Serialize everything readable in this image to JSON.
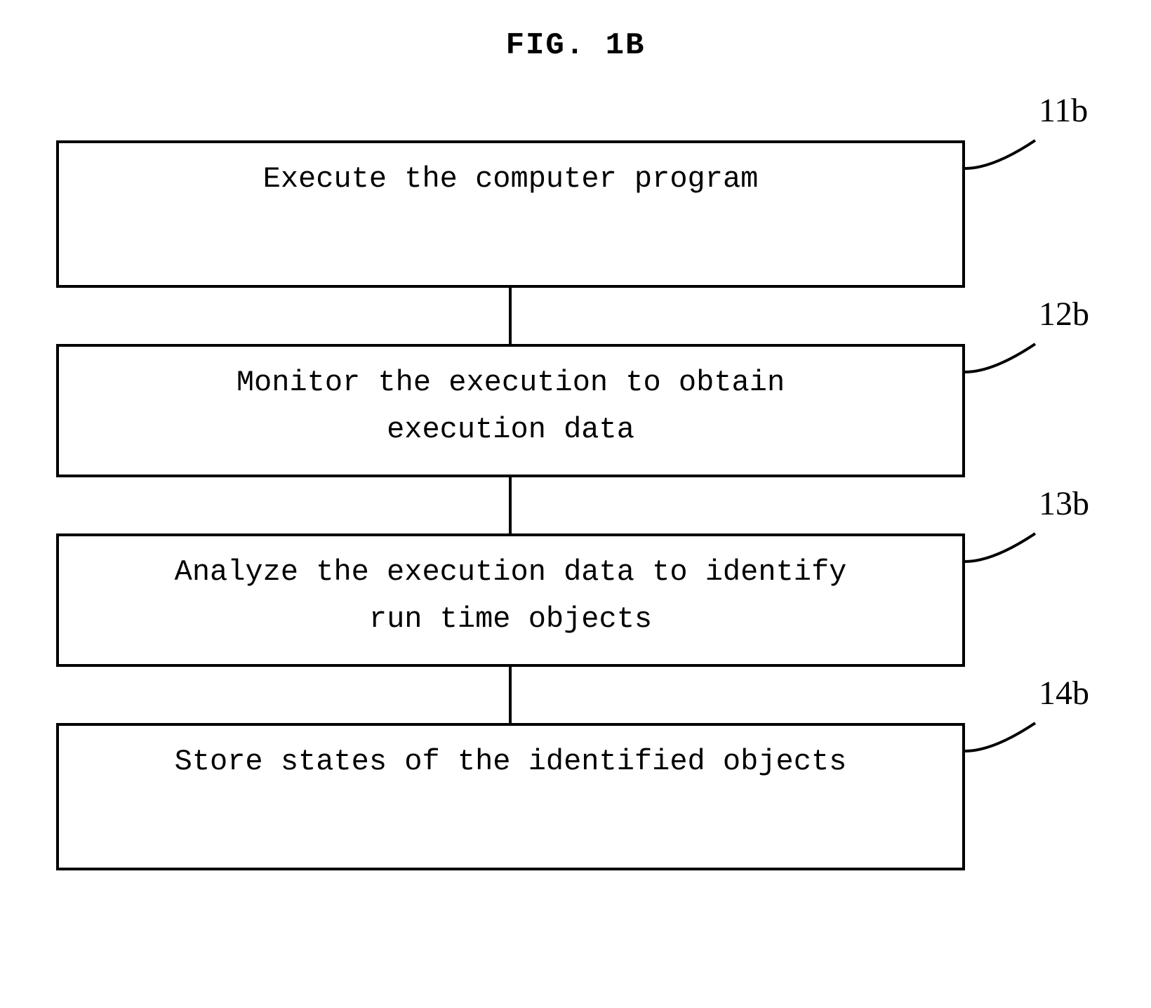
{
  "title": "FIG. 1B",
  "steps": [
    {
      "text": "Execute the computer program",
      "label": "11b"
    },
    {
      "text": "Monitor the execution to obtain\nexecution data",
      "label": "12b"
    },
    {
      "text": "Analyze the execution data to identify\nrun time objects",
      "label": "13b"
    },
    {
      "text": "Store states of the identified objects",
      "label": "14b"
    }
  ]
}
